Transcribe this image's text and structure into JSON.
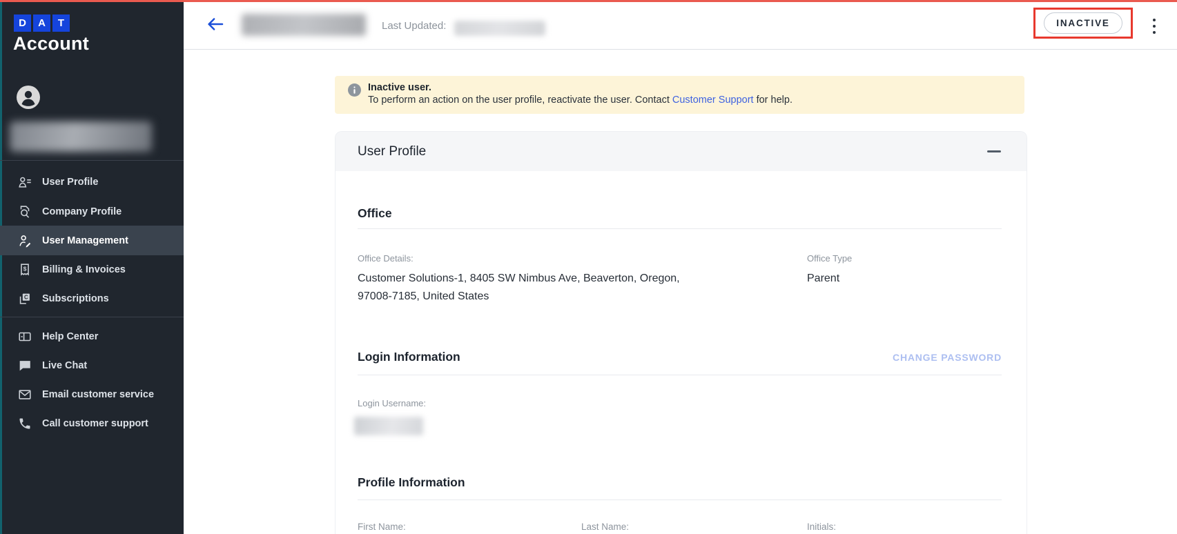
{
  "app": {
    "logo_letters": [
      "D",
      "A",
      "T"
    ],
    "title": "Account"
  },
  "sidebar": {
    "nav": [
      {
        "label": "User Profile",
        "selected": false
      },
      {
        "label": "Company Profile",
        "selected": false
      },
      {
        "label": "User Management",
        "selected": true
      },
      {
        "label": "Billing & Invoices",
        "selected": false
      },
      {
        "label": "Subscriptions",
        "selected": false
      }
    ],
    "support_nav": [
      {
        "label": "Help Center"
      },
      {
        "label": "Live Chat"
      },
      {
        "label": "Email customer service"
      },
      {
        "label": "Call customer support"
      }
    ]
  },
  "topbar": {
    "last_updated_label": "Last Updated:",
    "status_badge": "INACTIVE"
  },
  "banner": {
    "title": "Inactive user.",
    "body_prefix": "To perform an action on the user profile, reactivate the user. Contact ",
    "link_text": "Customer Support",
    "body_suffix": " for help."
  },
  "card": {
    "title": "User Profile",
    "office": {
      "heading": "Office",
      "details_label": "Office Details:",
      "details_value": "Customer Solutions-1, 8405 SW Nimbus Ave, Beaverton, Oregon, 97008-7185, United States",
      "type_label": "Office Type",
      "type_value": "Parent"
    },
    "login": {
      "heading": "Login Information",
      "action_label": "CHANGE PASSWORD",
      "username_label": "Login Username:"
    },
    "profile": {
      "heading": "Profile Information",
      "first_name_label": "First Name:",
      "last_name_label": "Last Name:",
      "initials_label": "Initials:"
    }
  },
  "colors": {
    "brand_blue": "#1544dc",
    "link_blue": "#3e62e0",
    "banner_bg": "#fdf4d8",
    "annotation_red": "#e8392e",
    "sidebar_bg": "#20262e",
    "selected_nav_bg": "#3a434e",
    "teal_strip": "#12626d",
    "status_text": "#222b37"
  }
}
